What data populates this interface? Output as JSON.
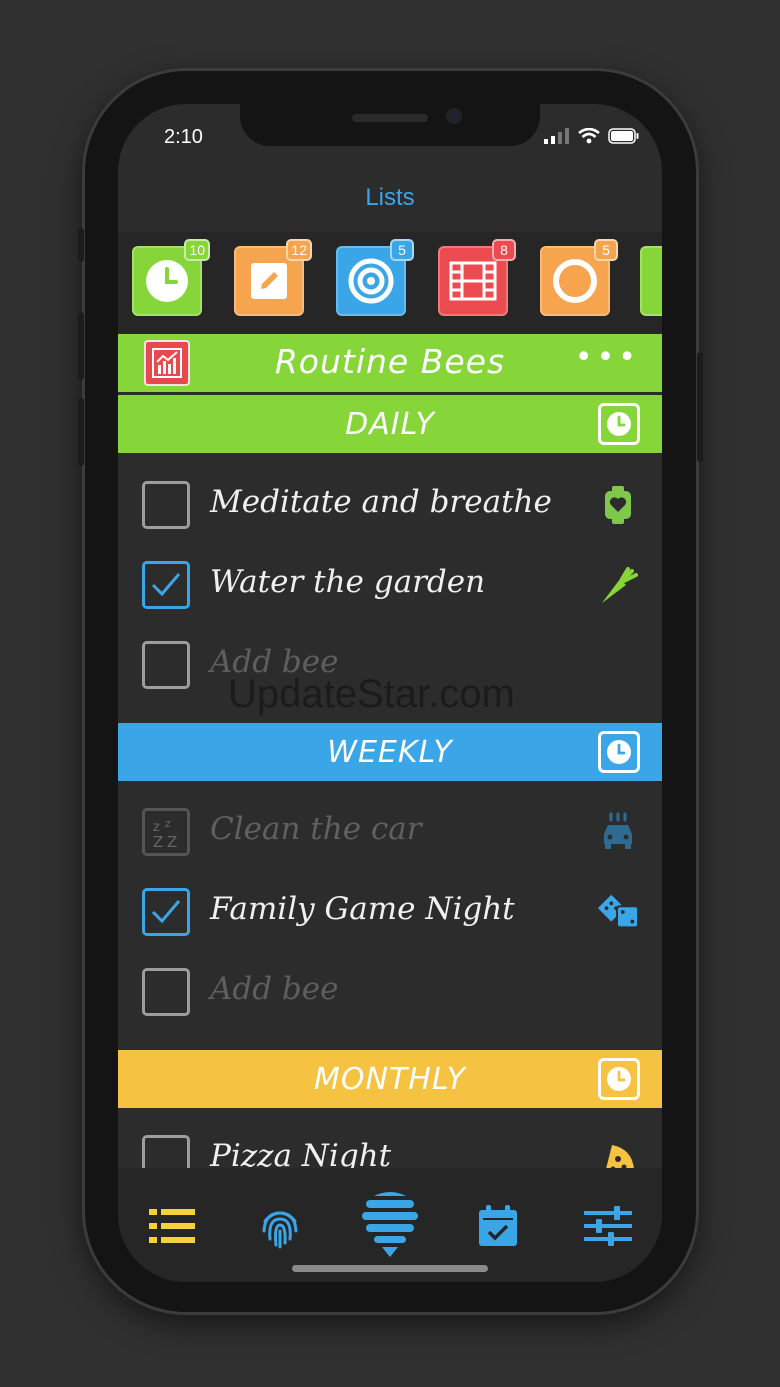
{
  "status": {
    "time": "2:10"
  },
  "nav": {
    "title": "Lists"
  },
  "categories": [
    {
      "icon": "clock-icon",
      "color": "#86d63a",
      "badge": "10"
    },
    {
      "icon": "pencil-icon",
      "color": "#f7a44e",
      "badge": "12"
    },
    {
      "icon": "target-icon",
      "color": "#3aa6e8",
      "badge": "5"
    },
    {
      "icon": "film-icon",
      "color": "#ec4c50",
      "badge": "8"
    },
    {
      "icon": "ring-icon",
      "color": "#f7a44e",
      "badge": "5"
    },
    {
      "icon": "tag-icon",
      "color": "#86d63a",
      "badge": ""
    }
  ],
  "list": {
    "title": "Routine Bees",
    "color": "#86d63a"
  },
  "sections": [
    {
      "label": "DAILY",
      "color": "#86d63a",
      "items": [
        {
          "text": "Meditate and breathe",
          "checked": false,
          "icon": "watch-heart-icon"
        },
        {
          "text": "Water the garden",
          "checked": true,
          "icon": "carrot-icon"
        },
        {
          "text": "Add bee",
          "checked": false,
          "placeholder": true
        }
      ]
    },
    {
      "label": "WEEKLY",
      "color": "#3aa6e8",
      "items": [
        {
          "text": "Clean the car",
          "checked": false,
          "snoozed": true,
          "icon": "car-wash-icon"
        },
        {
          "text": "Family Game Night",
          "checked": true,
          "icon": "dice-icon"
        },
        {
          "text": "Add bee",
          "checked": false,
          "placeholder": true
        }
      ]
    },
    {
      "label": "MONTHLY",
      "color": "#f5c242",
      "items": [
        {
          "text": "Pizza Night",
          "checked": false,
          "icon": "pizza-icon"
        }
      ]
    }
  ],
  "watermark": "UpdateStar.com",
  "tabbar": [
    {
      "icon": "list-icon",
      "color": "#f5d23a"
    },
    {
      "icon": "fingerprint-icon",
      "color": "#3aa6e8"
    },
    {
      "icon": "bee-hive-icon",
      "color": "#3aa6e8"
    },
    {
      "icon": "calendar-check-icon",
      "color": "#3aa6e8"
    },
    {
      "icon": "sliders-icon",
      "color": "#3aa6e8"
    }
  ]
}
